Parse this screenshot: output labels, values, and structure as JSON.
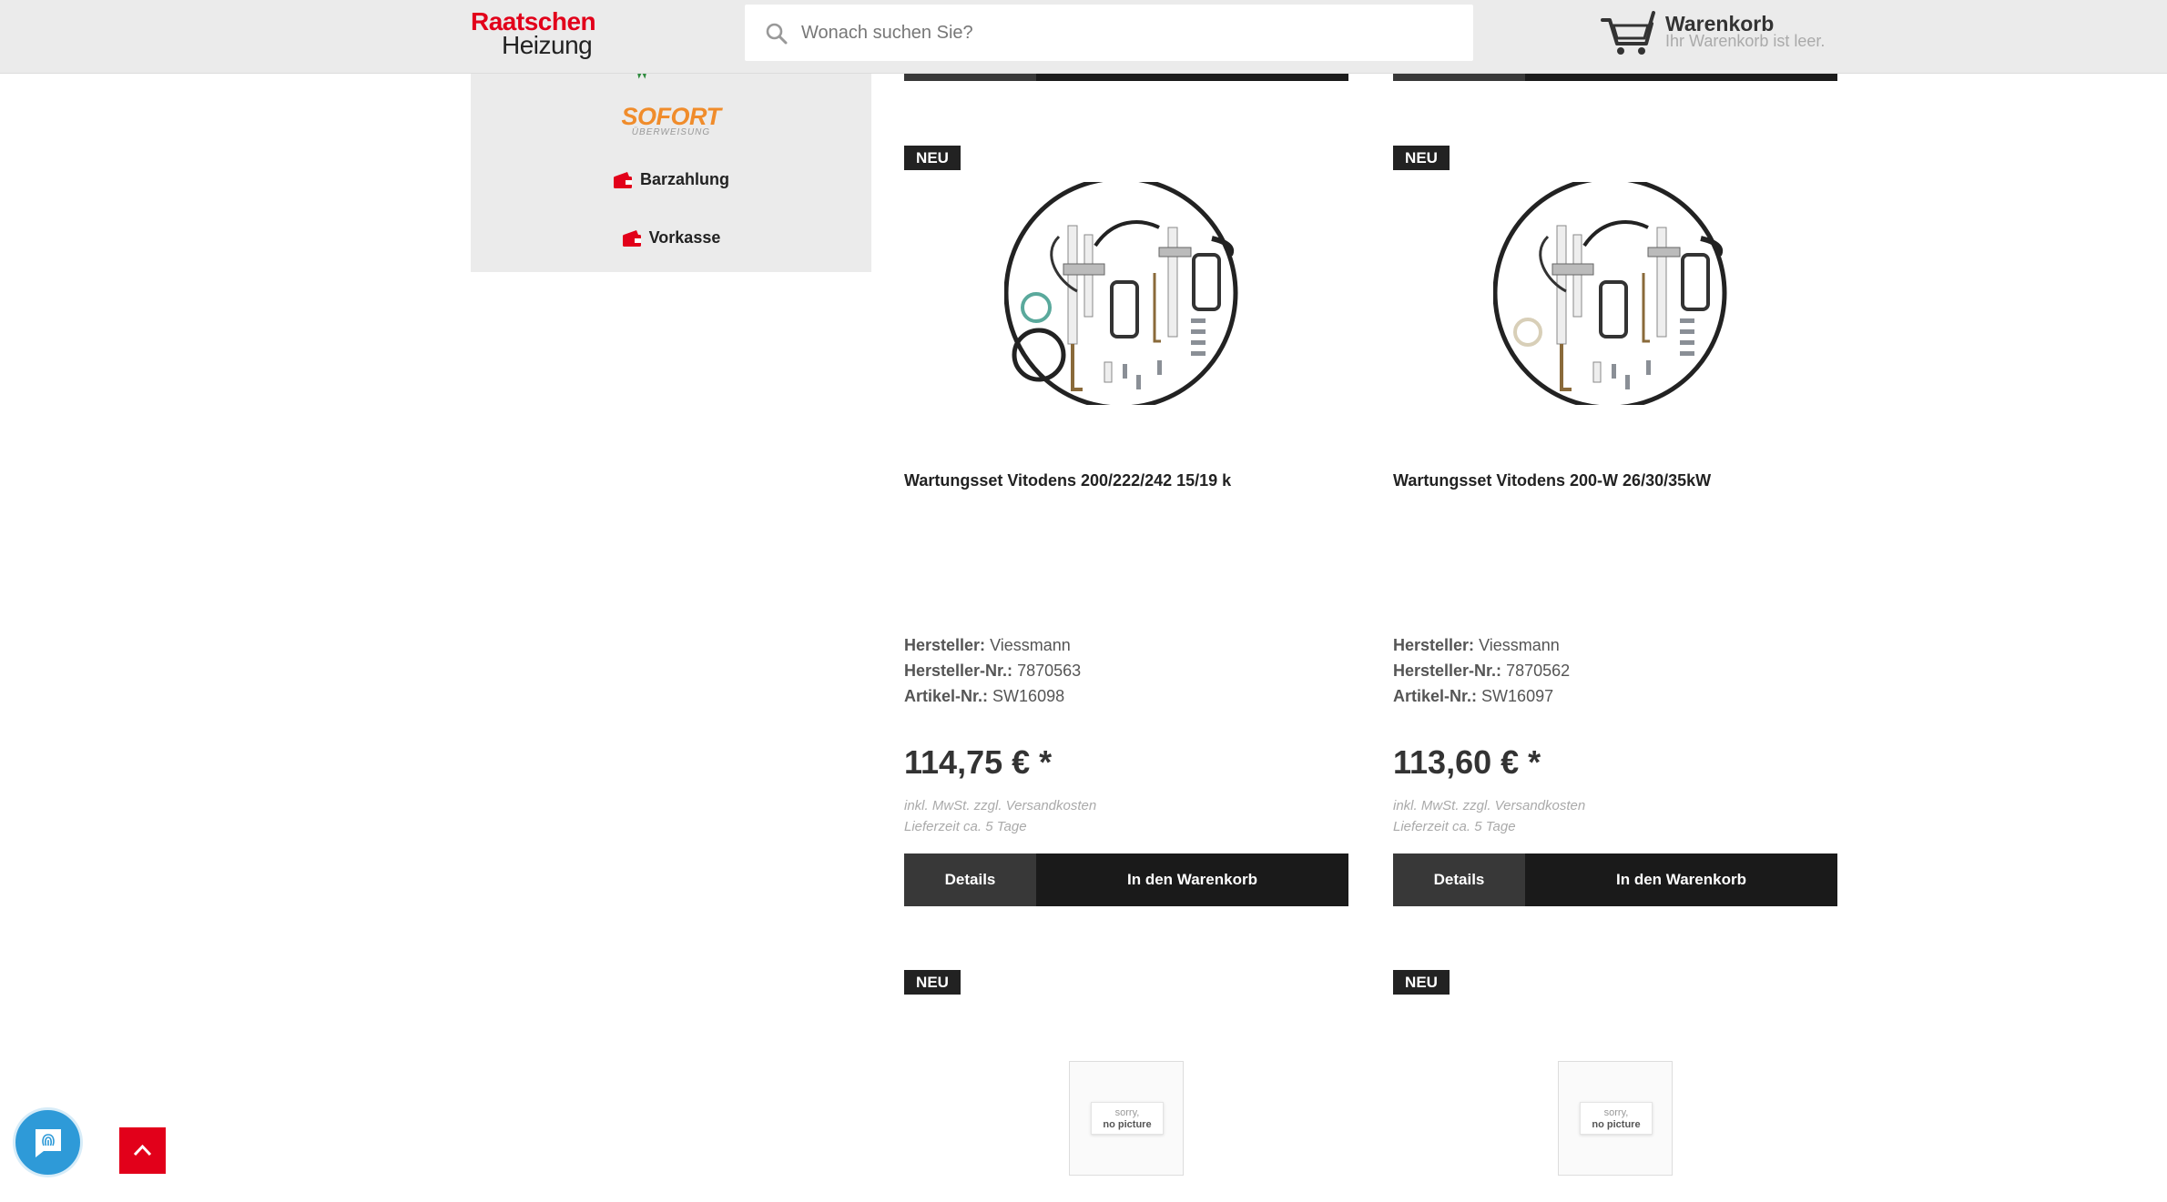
{
  "header": {
    "logo_line1": "Raatschen",
    "logo_line2": "Heizung",
    "search_placeholder": "Wonach suchen Sie?",
    "cart_title": "Warenkorb",
    "cart_status": "Ihr Warenkorb ist leer."
  },
  "payments": {
    "sofort_main": "SOFORT",
    "sofort_sub": "ÜBERWEISUNG",
    "barzahlung": "Barzahlung",
    "vorkasse": "Vorkasse"
  },
  "products": [
    {
      "badge": "NEU",
      "title": "Wartungsset Vitodens 200/222/242 15/19 k",
      "manufacturer_label": "Hersteller:",
      "manufacturer": "Viessmann",
      "mpn_label": "Hersteller-Nr.:",
      "mpn": "7870563",
      "sku_label": "Artikel-Nr.:",
      "sku": "SW16098",
      "price": "114,75 € *",
      "vat_note": "inkl. MwSt. zzgl. Versandkosten",
      "delivery": "Lieferzeit ca. 5 Tage",
      "details_label": "Details",
      "cart_label": "In den Warenkorb"
    },
    {
      "badge": "NEU",
      "title": "Wartungsset Vitodens 200-W 26/30/35kW",
      "manufacturer_label": "Hersteller:",
      "manufacturer": "Viessmann",
      "mpn_label": "Hersteller-Nr.:",
      "mpn": "7870562",
      "sku_label": "Artikel-Nr.:",
      "sku": "SW16097",
      "price": "113,60 € *",
      "vat_note": "inkl. MwSt. zzgl. Versandkosten",
      "delivery": "Lieferzeit ca. 5 Tage",
      "details_label": "Details",
      "cart_label": "In den Warenkorb"
    }
  ],
  "next_products": [
    {
      "badge": "NEU",
      "nopic_line1": "sorry,",
      "nopic_line2": "no picture"
    },
    {
      "badge": "NEU",
      "nopic_line1": "sorry,",
      "nopic_line2": "no picture"
    }
  ],
  "colors": {
    "brand_red": "#e2001a",
    "button_dark": "#1a1a1a",
    "chat_blue": "#2e9ad8"
  }
}
